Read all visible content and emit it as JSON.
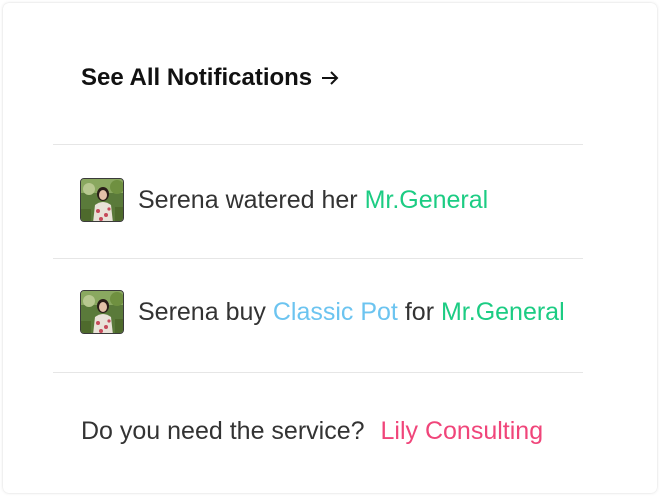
{
  "header": {
    "title": "See All Notifications",
    "arrow_icon": "arrow-right-icon"
  },
  "notifications": [
    {
      "avatar_icon": "user-avatar-photo",
      "actor": "Serena",
      "text_1": "watered her",
      "plant": "Mr.General"
    },
    {
      "avatar_icon": "user-avatar-photo",
      "actor": "Serena",
      "text_1": "buy",
      "item": "Classic Pot",
      "text_2": "for",
      "plant": "Mr.General"
    }
  ],
  "footer": {
    "question": "Do you need the service?",
    "service_link": "Lily Consulting"
  },
  "colors": {
    "plant_link": "#1ccc83",
    "item_link": "#6cc4f0",
    "service_link": "#f0457a",
    "text": "#333333",
    "divider": "#e6e6e6"
  }
}
